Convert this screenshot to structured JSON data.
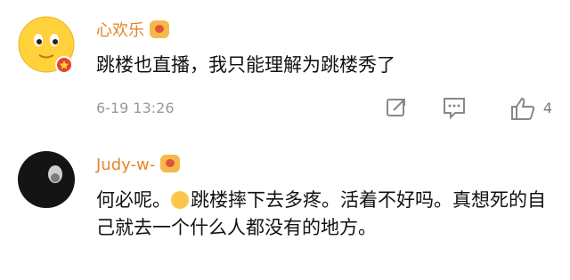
{
  "comments": [
    {
      "username": "心欢乐",
      "text": "跳楼也直播，我只能理解为跳楼秀了",
      "time": "6-19 13:26",
      "likes": "4",
      "avatar_icon": "smiley-face-icon",
      "accent": "#e5842a"
    },
    {
      "username": "Judy-w-",
      "text_before_emoji": "何必呢。",
      "text_after_emoji": "跳楼摔下去多疼。活着不好吗。真想死的自己就去一个什么人都没有的地方。",
      "avatar_icon": "dark-photo-avatar",
      "emoji_icon": "smile-emoji-icon"
    }
  ]
}
